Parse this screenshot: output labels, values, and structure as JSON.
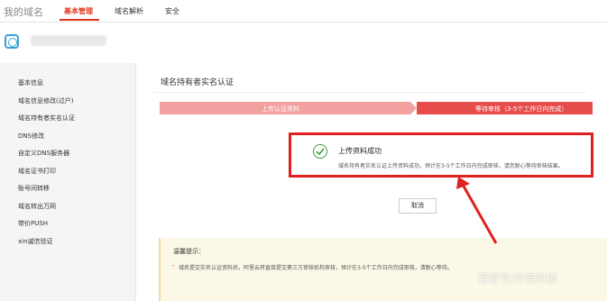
{
  "header": {
    "brand": "我的域名",
    "tabs": [
      {
        "label": "基本管理",
        "active": true
      },
      {
        "label": "域名解析",
        "active": false
      },
      {
        "label": "安全",
        "active": false
      }
    ]
  },
  "sidebar": {
    "items": [
      {
        "label": "基本信息"
      },
      {
        "label": "域名信息修改(过户)"
      },
      {
        "label": "域名持有者实名认证"
      },
      {
        "label": "DNS修改"
      },
      {
        "label": "自定义DNS服务器"
      },
      {
        "label": "域名证书打印"
      },
      {
        "label": "账号间转移"
      },
      {
        "label": "域名转出万网"
      },
      {
        "label": "带价PUSH"
      },
      {
        "label": "xin诚信验证"
      }
    ]
  },
  "main": {
    "title": "域名持有者实名认证",
    "steps": [
      {
        "label": "上传认证资料"
      },
      {
        "label": "等待审核（3-5个工作日内完成）"
      }
    ],
    "success": {
      "title": "上传资料成功",
      "description": "域名持有者实名认证上传资料成功，预计在3-5个工作日内完成审核，请您耐心等待审核结果。"
    },
    "cancel_label": "取消",
    "notice": {
      "title": "温馨提示：",
      "bullet": "•",
      "text": "域名提交实名认证资料后，阿里云将直接提交第三方审核机构审核，预计在3-5个工作日内完成审核，请耐心等待。"
    }
  },
  "watermark": "百家号/开若科技",
  "colors": {
    "accent": "#e0321e",
    "step_done": "#f2a0a0",
    "step_current": "#e74c4c",
    "annotation_red": "#e02020",
    "success_green": "#3a9d3a"
  }
}
